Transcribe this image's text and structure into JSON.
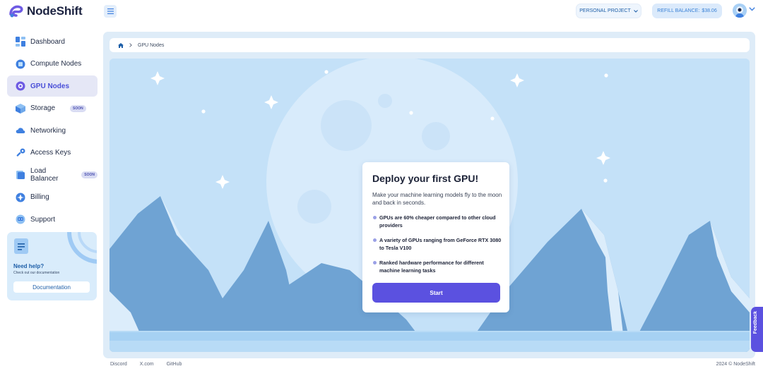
{
  "brand": {
    "name": "NodeShift"
  },
  "sidebar": {
    "items": [
      {
        "label": "Dashboard",
        "badge": "",
        "active": false
      },
      {
        "label": "Compute Nodes",
        "badge": "",
        "active": false
      },
      {
        "label": "GPU Nodes",
        "badge": "",
        "active": true
      },
      {
        "label": "Storage",
        "badge": "SOON",
        "active": false
      },
      {
        "label": "Networking",
        "badge": "",
        "active": false
      },
      {
        "label": "Access Keys",
        "badge": "",
        "active": false
      },
      {
        "label": "Load Balancer",
        "badge": "SOON",
        "active": false
      },
      {
        "label": "Billing",
        "badge": "",
        "active": false
      },
      {
        "label": "Support",
        "badge": "",
        "active": false
      }
    ],
    "help": {
      "title": "Need help?",
      "subtitle": "Check out our documentation",
      "button": "Documentation"
    }
  },
  "header": {
    "project": "PERSONAL PROJECT",
    "balance_label": "REFILL BALANCE:",
    "balance_value": "$38.06"
  },
  "breadcrumb": {
    "current": "GPU Nodes"
  },
  "card": {
    "title": "Deploy your first GPU!",
    "description": "Make your machine learning models fly to the moon and back in seconds.",
    "bullets": [
      "GPUs are 60% cheaper compared to other cloud providers",
      "A variety of GPUs ranging from GeForce RTX 3080 to Tesla V100",
      "Ranked hardware performance for different machine learning tasks"
    ],
    "button": "Start"
  },
  "footer": {
    "links": [
      "Discord",
      "X.com",
      "GitHub"
    ],
    "copyright": "2024 © NodeShift"
  },
  "feedback": {
    "label": "Feedback"
  },
  "colors": {
    "accent": "#5b51e0",
    "primary_blue": "#1e5fa8",
    "hero_bg": "#c4e1f8"
  }
}
